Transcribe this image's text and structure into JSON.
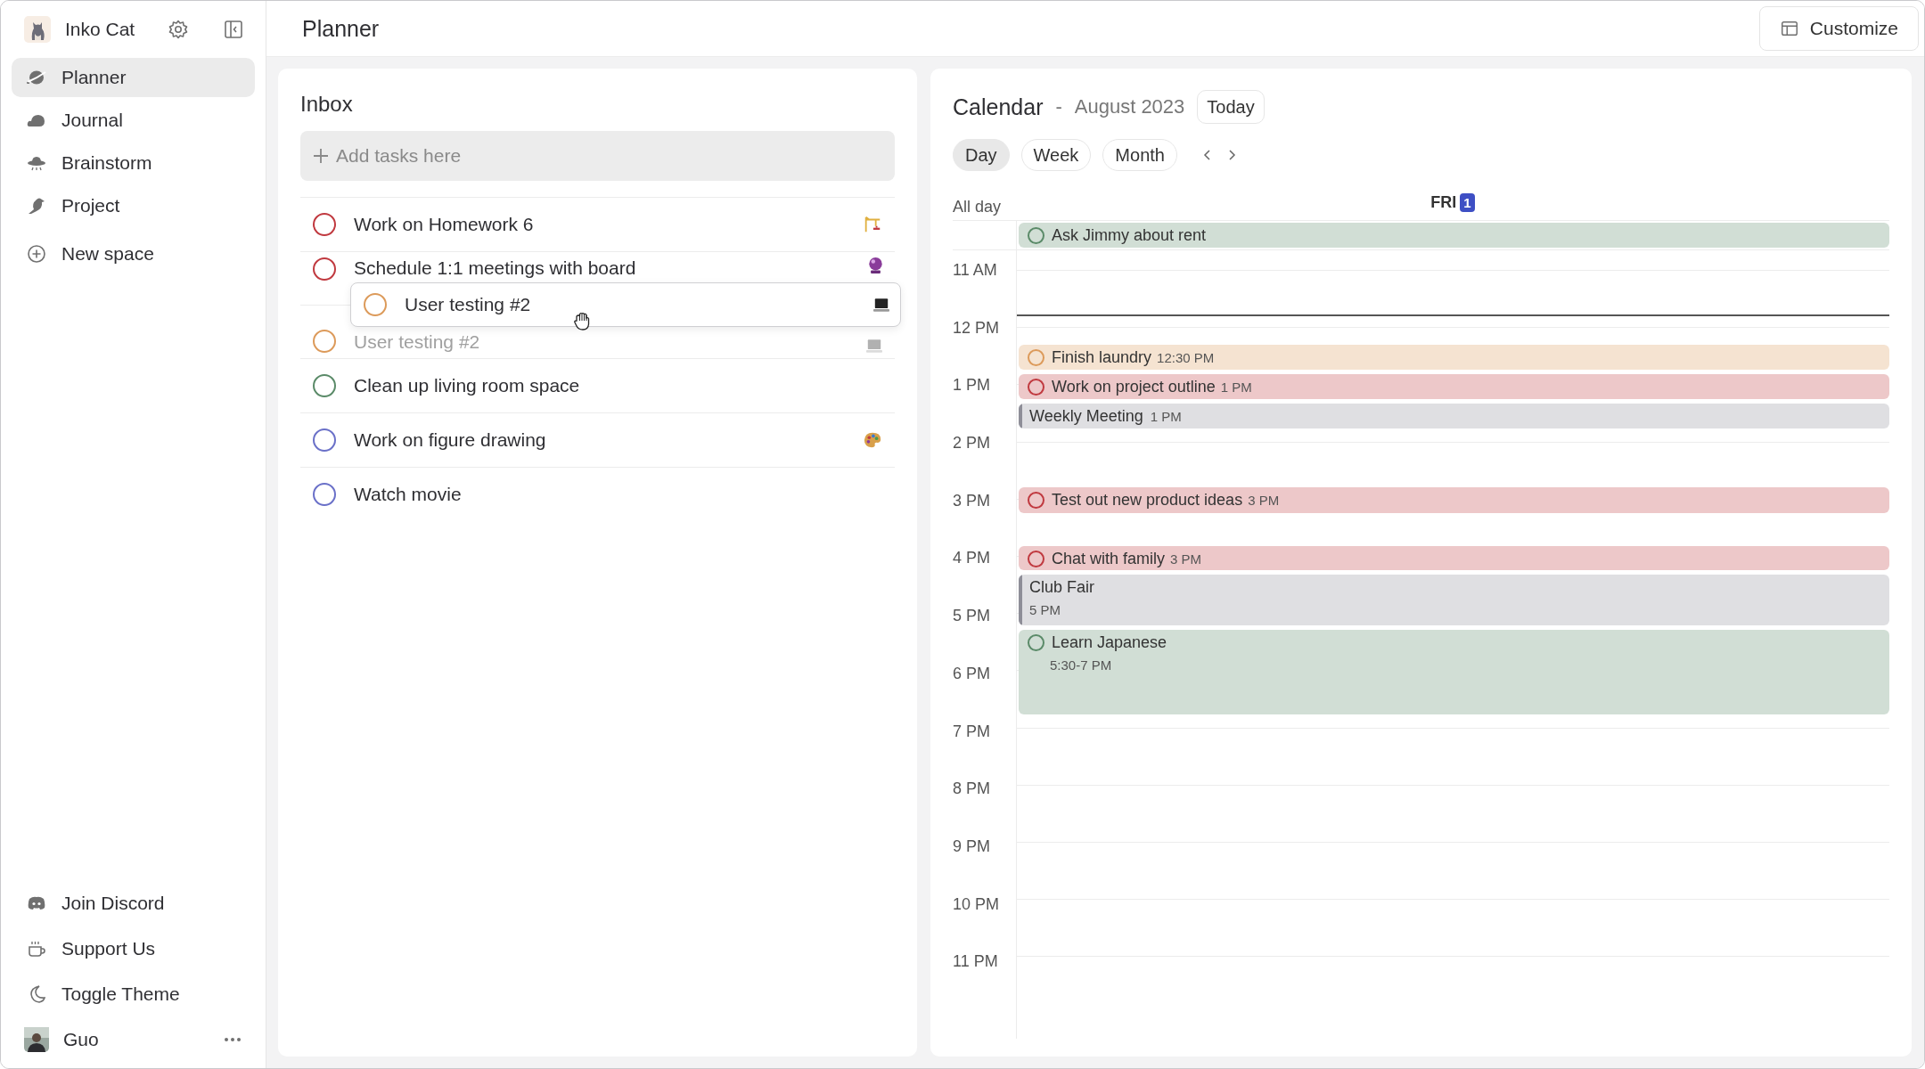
{
  "sidebar": {
    "workspace": {
      "name": "Inko Cat"
    },
    "items": [
      {
        "label": "Planner",
        "selected": true
      },
      {
        "label": "Journal",
        "selected": false
      },
      {
        "label": "Brainstorm",
        "selected": false
      },
      {
        "label": "Project",
        "selected": false
      },
      {
        "label": "New space",
        "selected": false
      }
    ],
    "footer_items": [
      {
        "label": "Join Discord"
      },
      {
        "label": "Support Us"
      },
      {
        "label": "Toggle Theme"
      }
    ],
    "user": {
      "name": "Guo"
    }
  },
  "header": {
    "title": "Planner",
    "customize_button": "Customize"
  },
  "inbox": {
    "title": "Inbox",
    "add_task": {
      "placeholder": "Add tasks here"
    },
    "tasks": [
      {
        "title": "Work on Homework 6",
        "color": "#c0393f",
        "ghost": false
      },
      {
        "title": "Schedule 1:1 meetings with board",
        "color": "#c0393f",
        "ghost": false
      },
      {
        "title": "User testing #2",
        "color": "#dc9a5a",
        "ghost": true
      },
      {
        "title": "Clean up living room space",
        "color": "#5a8a68",
        "ghost": false
      },
      {
        "title": "Work on figure drawing",
        "color": "#6a70c8",
        "ghost": false
      },
      {
        "title": "Watch movie",
        "color": "#6a70c8",
        "ghost": false
      }
    ],
    "drag_preview": {
      "title": "User testing #2",
      "color": "#dc9a5a"
    }
  },
  "calendar": {
    "title": "Calendar",
    "separator": "-",
    "month": "August 2023",
    "today_button": "Today",
    "views": [
      {
        "label": "Day",
        "selected": true
      },
      {
        "label": "Week",
        "selected": false
      },
      {
        "label": "Month",
        "selected": false
      }
    ],
    "day": {
      "weekday": "FRI",
      "date": "1"
    },
    "all_day": {
      "label": "All day",
      "events": [
        {
          "title": "Ask Jimmy about rent",
          "kind": "task",
          "color": "#5a8a68"
        }
      ]
    },
    "hours": [
      "11 AM",
      "12 PM",
      "1 PM",
      "2 PM",
      "3 PM",
      "4 PM",
      "5 PM",
      "6 PM",
      "7 PM",
      "8 PM",
      "9 PM",
      "10 PM",
      "11 PM"
    ],
    "events": [
      {
        "title": "Finish laundry",
        "time": "12:30 PM",
        "kind": "task",
        "color": "#dc9a5a"
      },
      {
        "title": "Work on project outline",
        "time": "1 PM",
        "kind": "task",
        "color": "#c0393f"
      },
      {
        "title": "Weekly Meeting",
        "time": "1 PM",
        "kind": "event",
        "color": "#8e8e98"
      },
      {
        "title": "Test out new product ideas",
        "time": "3 PM",
        "kind": "task",
        "color": "#c0393f"
      },
      {
        "title": "Chat with family",
        "time": "3 PM",
        "kind": "task",
        "color": "#c0393f"
      },
      {
        "title": "Club Fair",
        "time": "5 PM",
        "kind": "event",
        "color": "#8e8e98"
      },
      {
        "title": "Learn Japanese",
        "time": "5:30-7 PM",
        "kind": "task",
        "color": "#5a8a68"
      }
    ]
  }
}
